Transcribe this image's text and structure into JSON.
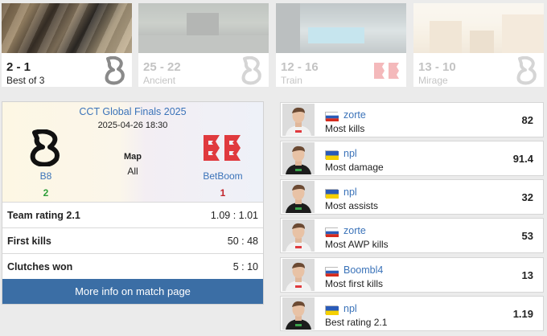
{
  "maps": [
    {
      "score": "2 - 1",
      "name": "Best of 3",
      "active": true
    },
    {
      "score": "25 - 22",
      "name": "Ancient",
      "active": false
    },
    {
      "score": "12 - 16",
      "name": "Train",
      "active": false
    },
    {
      "score": "13 - 10",
      "name": "Mirage",
      "active": false
    }
  ],
  "match": {
    "event": "CCT Global Finals 2025",
    "date": "2025-04-26 18:30",
    "map_label": "Map",
    "map_value": "All",
    "team1": {
      "name": "B8",
      "score": "2",
      "score_color": "#2e9e3a"
    },
    "team2": {
      "name": "BetBoom",
      "score": "1",
      "score_color": "#c2242a"
    },
    "stats": [
      {
        "label": "Team rating 2.1",
        "value": "1.09 : 1.01"
      },
      {
        "label": "First kills",
        "value": "50 : 48"
      },
      {
        "label": "Clutches won",
        "value": "5 : 10"
      }
    ],
    "more_info": "More info on match page"
  },
  "players": [
    {
      "name": "zorte",
      "flag": "russia",
      "desc": "Most kills",
      "value": "82",
      "team": "betboom"
    },
    {
      "name": "npl",
      "flag": "ukraine",
      "desc": "Most damage",
      "value": "91.4",
      "team": "b8"
    },
    {
      "name": "npl",
      "flag": "ukraine",
      "desc": "Most assists",
      "value": "32",
      "team": "b8"
    },
    {
      "name": "zorte",
      "flag": "russia",
      "desc": "Most AWP kills",
      "value": "53",
      "team": "betboom"
    },
    {
      "name": "Boombl4",
      "flag": "russia",
      "desc": "Most first kills",
      "value": "13",
      "team": "betboom"
    },
    {
      "name": "npl",
      "flag": "ukraine",
      "desc": "Best rating 2.1",
      "value": "1.19",
      "team": "b8"
    }
  ],
  "colors": {
    "link": "#3b73b9",
    "button": "#3b6ea5",
    "betboom_red": "#e03a3e"
  }
}
